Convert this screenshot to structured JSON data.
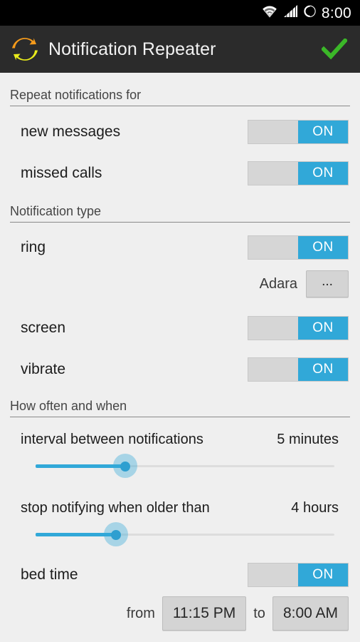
{
  "status_bar": {
    "time": "8:00",
    "icons": [
      "wifi-icon",
      "cell-signal-icon",
      "battery-icon"
    ]
  },
  "action_bar": {
    "app_icon": "repeat-refresh-icon",
    "title": "Notification Repeater",
    "confirm_icon": "checkmark-icon",
    "confirm_color": "#3bb728",
    "background": "#2b2b2b"
  },
  "theme": {
    "accent": "#31a8d8",
    "background": "#efefef",
    "switch_track": "#d6d6d6",
    "button_gray": "#d4d4d4",
    "text": "#1c1c1c",
    "header_text": "#454545"
  },
  "sections": [
    {
      "title": "Repeat notifications for",
      "rows": [
        {
          "label": "new messages",
          "switch_state": "ON"
        },
        {
          "label": "missed calls",
          "switch_state": "ON"
        }
      ]
    },
    {
      "title": "Notification type",
      "rows": [
        {
          "label": "ring",
          "switch_state": "ON"
        },
        {
          "label": "screen",
          "switch_state": "ON"
        },
        {
          "label": "vibrate",
          "switch_state": "ON"
        }
      ],
      "ringtone": {
        "name": "Adara",
        "button_label": "...",
        "button_icon": "ellipsis-icon"
      }
    },
    {
      "title": "How often and when",
      "sliders": [
        {
          "label": "interval between notifications",
          "value": "5 minutes",
          "fill_percent": 30
        },
        {
          "label": "stop notifying when older than",
          "value": "4 hours",
          "fill_percent": 27
        }
      ],
      "bed_time": {
        "label": "bed time",
        "switch_state": "ON",
        "from_word": "from",
        "from_time": "11:15 PM",
        "to_word": "to",
        "to_time": "8:00 AM"
      }
    }
  ]
}
